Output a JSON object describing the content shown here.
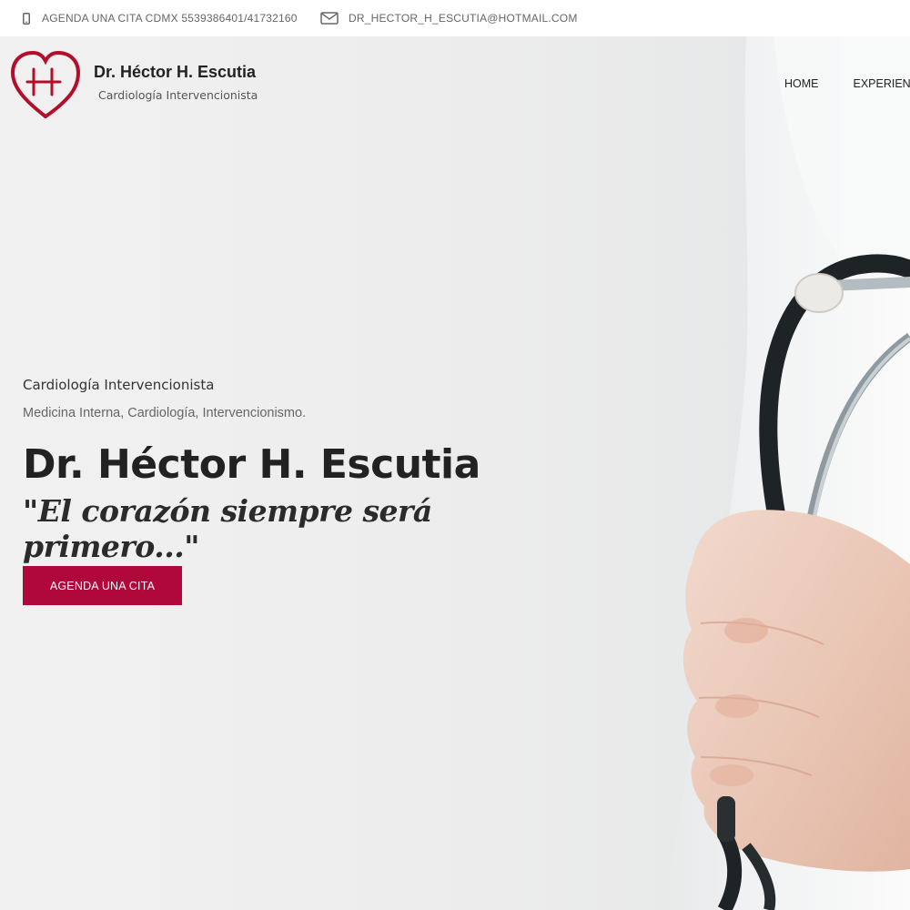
{
  "topbar": {
    "phone_text": "AGENDA UNA CITA CDMX 5539386401/41732160",
    "email_text": "DR_HECTOR_H_ESCUTIA@HOTMAIL.COM"
  },
  "brand": {
    "name": "Dr. Héctor H. Escutia",
    "subtitle": "Cardiología Intervencionista",
    "accent_color": "#b0083a"
  },
  "nav": {
    "items": [
      "HOME",
      "EXPERIENC"
    ]
  },
  "hero": {
    "eyebrow": "Cardiología Intervencionista",
    "specialties": "Medicina Interna, Cardiología, Intervencionismo.",
    "headline": "Dr. Héctor H. Escutia",
    "tagline": "\"El corazón siempre será primero...\"",
    "cta_label": "AGENDA UNA CITA"
  },
  "icons": {
    "phone": "mobile-phone-icon",
    "email": "envelope-icon",
    "logo": "heart-h-logo-icon"
  }
}
